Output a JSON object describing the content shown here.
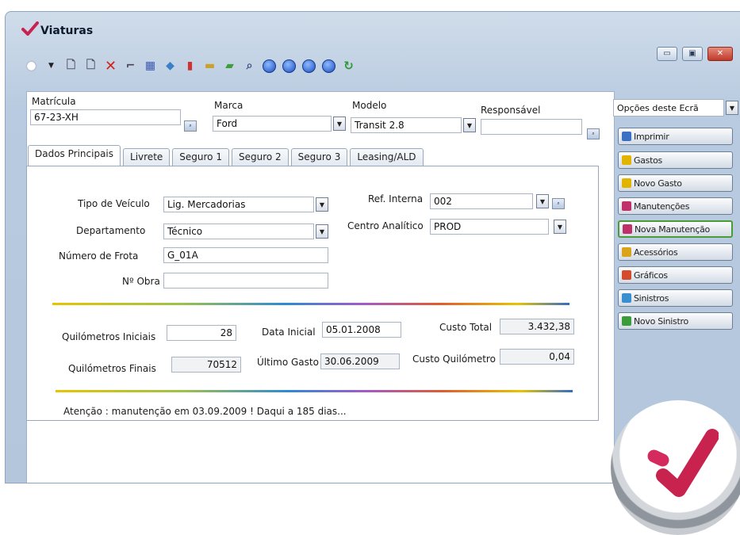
{
  "window": {
    "title": "Viaturas",
    "minimize": "▭",
    "maximize": "▣",
    "close": "✕"
  },
  "toolbar": [
    "new-icon",
    "dropdown-icon",
    "document-icon",
    "copy-icon",
    "delete-icon",
    "edit-icon",
    "grid-icon",
    "view-icon",
    "chart-icon",
    "table-icon",
    "print-icon",
    "search-icon",
    "nav-first-icon",
    "nav-prev-icon",
    "nav-next-icon",
    "nav-last-icon",
    "refresh-icon"
  ],
  "header": {
    "matricula_label": "Matrícula",
    "matricula_value": "67-23-XH",
    "marca_label": "Marca",
    "marca_value": "Ford",
    "modelo_label": "Modelo",
    "modelo_value": "Transit 2.8",
    "responsavel_label": "Responsável",
    "responsavel_value": ""
  },
  "tabs": [
    {
      "label": "Dados Principais"
    },
    {
      "label": "Livrete"
    },
    {
      "label": "Seguro 1"
    },
    {
      "label": "Seguro 2"
    },
    {
      "label": "Seguro 3"
    },
    {
      "label": "Leasing/ALD"
    }
  ],
  "form": {
    "tipo_label": "Tipo de Veículo",
    "tipo_value": "Lig. Mercadorias",
    "departamento_label": "Departamento",
    "departamento_value": "Técnico",
    "frota_label": "Número de Frota",
    "frota_value": "G_01A",
    "obra_label": "Nº Obra",
    "obra_value": "",
    "ref_label": "Ref. Interna",
    "ref_value": "002",
    "centro_label": "Centro Analítico",
    "centro_value": "PROD"
  },
  "stats": {
    "km_ini_label": "Quilómetros Iniciais",
    "km_ini_value": "28",
    "km_fin_label": "Quilómetros Finais",
    "km_fin_value": "70512",
    "data_ini_label": "Data Inicial",
    "data_ini_value": "05.01.2008",
    "ult_gasto_label": "Último Gasto",
    "ult_gasto_value": "30.06.2009",
    "custo_total_label": "Custo Total",
    "custo_total_value": "3.432,38",
    "custo_km_label": "Custo Quilómetro",
    "custo_km_value": "0,04"
  },
  "notice": "Atenção : manutenção em 03.09.2009 !  Daqui a 185 dias...",
  "sidebar": {
    "options_label": "Opções deste Ecrã",
    "buttons": [
      {
        "label": "Imprimir",
        "color": "#3b6fc4"
      },
      {
        "label": "Gastos",
        "color": "#e2b400"
      },
      {
        "label": "Novo Gasto",
        "color": "#e2b400"
      },
      {
        "label": "Manutenções",
        "color": "#c0306a"
      },
      {
        "label": "Nova Manutenção",
        "color": "#c0306a"
      },
      {
        "label": "Acessórios",
        "color": "#d9a31a"
      },
      {
        "label": "Gráficos",
        "color": "#d34a2c"
      },
      {
        "label": "Sinistros",
        "color": "#3a8fd1"
      },
      {
        "label": "Novo Sinistro",
        "color": "#3a9d3a"
      }
    ]
  }
}
